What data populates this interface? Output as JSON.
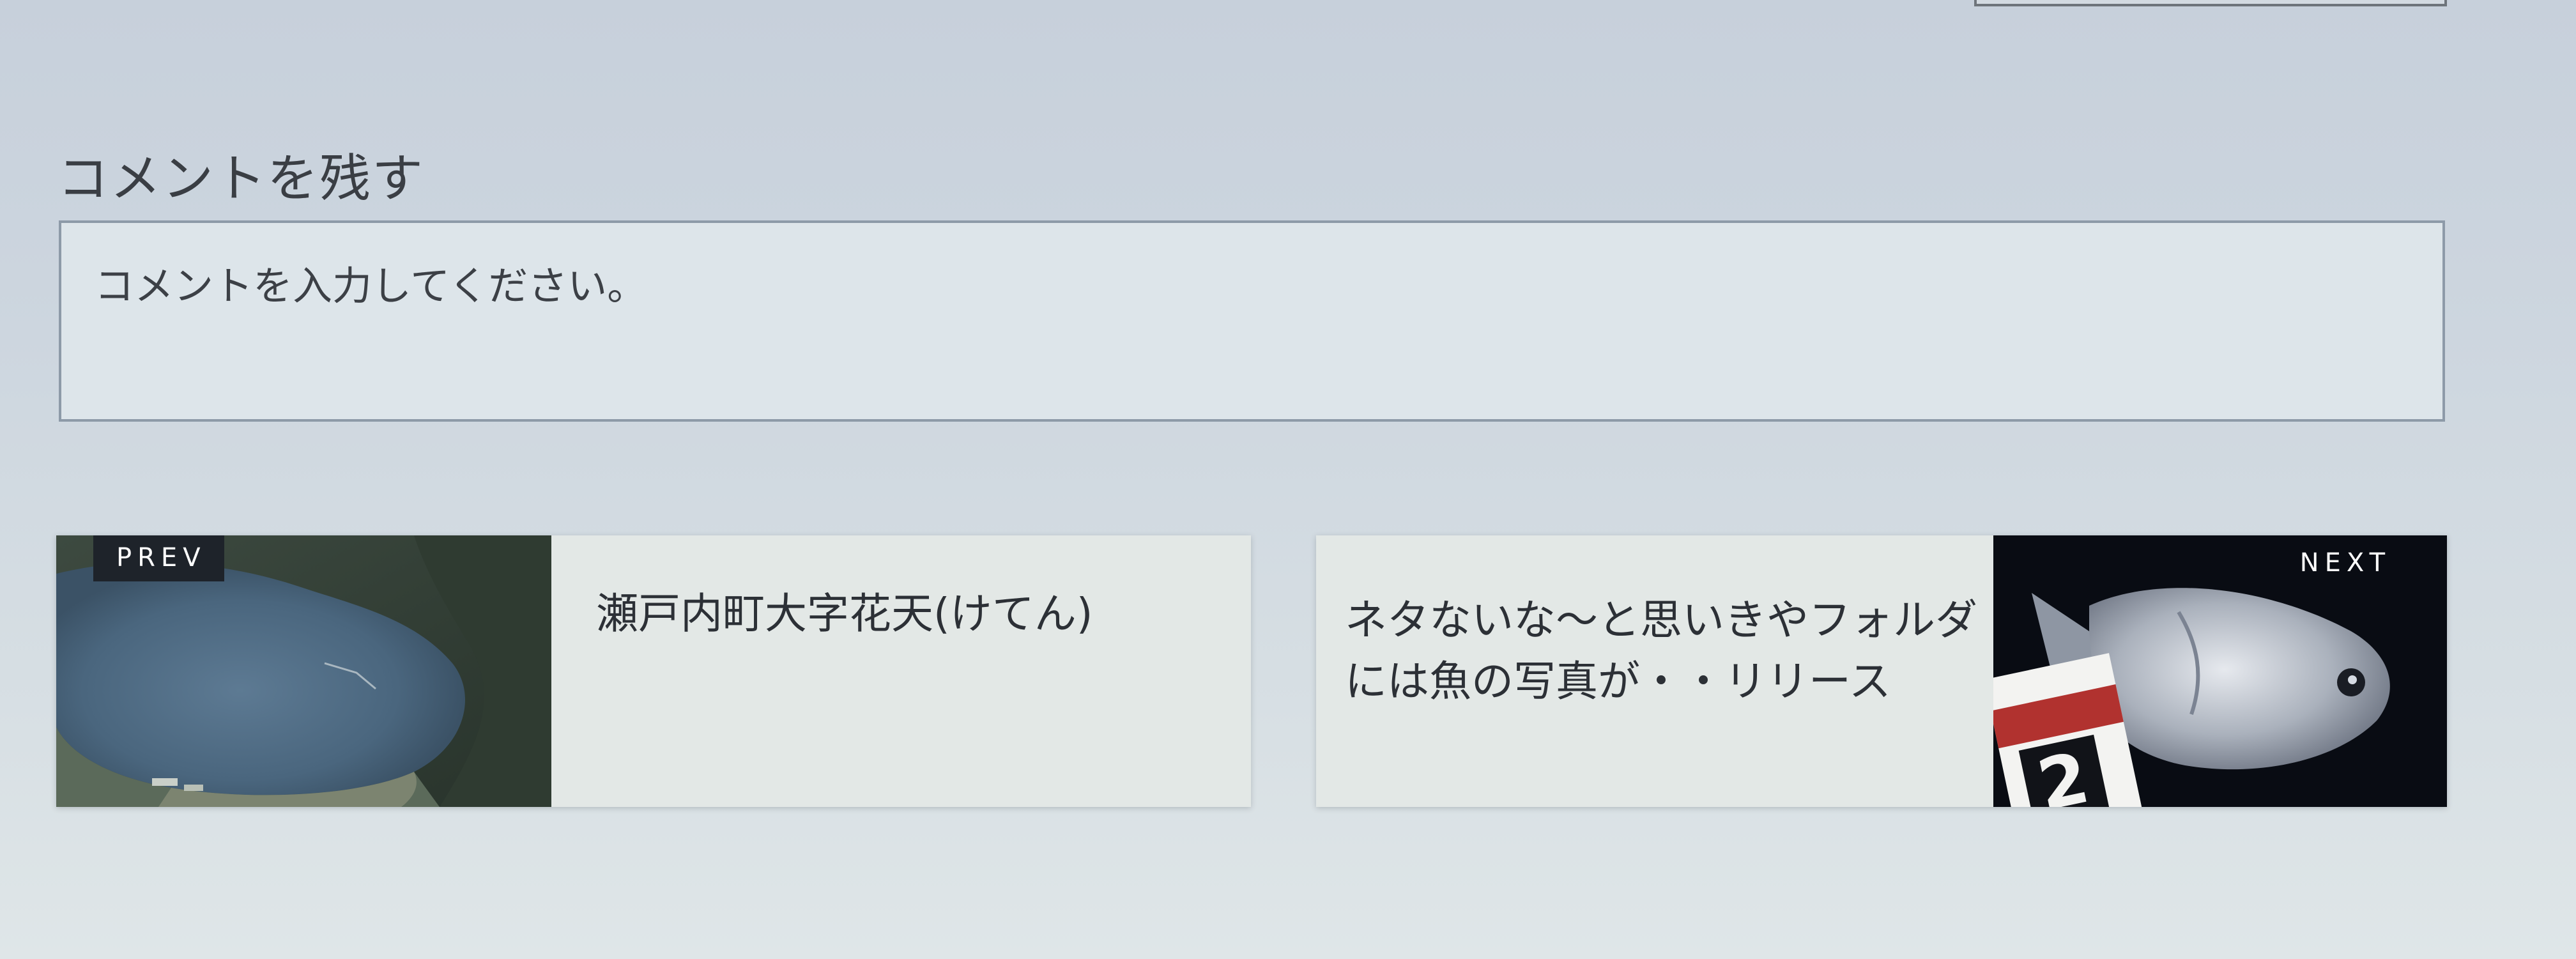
{
  "comment_section": {
    "heading": "コメントを残す",
    "placeholder": "コメントを入力してください。",
    "value": ""
  },
  "post_navigation": {
    "prev": {
      "badge": "PREV",
      "title": "瀬戸内町大字花天(けてん)",
      "thumbnail": "bay-aerial-photo"
    },
    "next": {
      "badge": "NEXT",
      "title": "ネタないな～と思いきやフォルダには魚の写真が・・リリース",
      "thumbnail": "fish-photo"
    }
  },
  "colors": {
    "background": "#cdd6df",
    "field_border": "#8d9aa8",
    "card_background": "#e3e8e6",
    "badge_background": "#1e232a",
    "text": "#2e3338"
  }
}
